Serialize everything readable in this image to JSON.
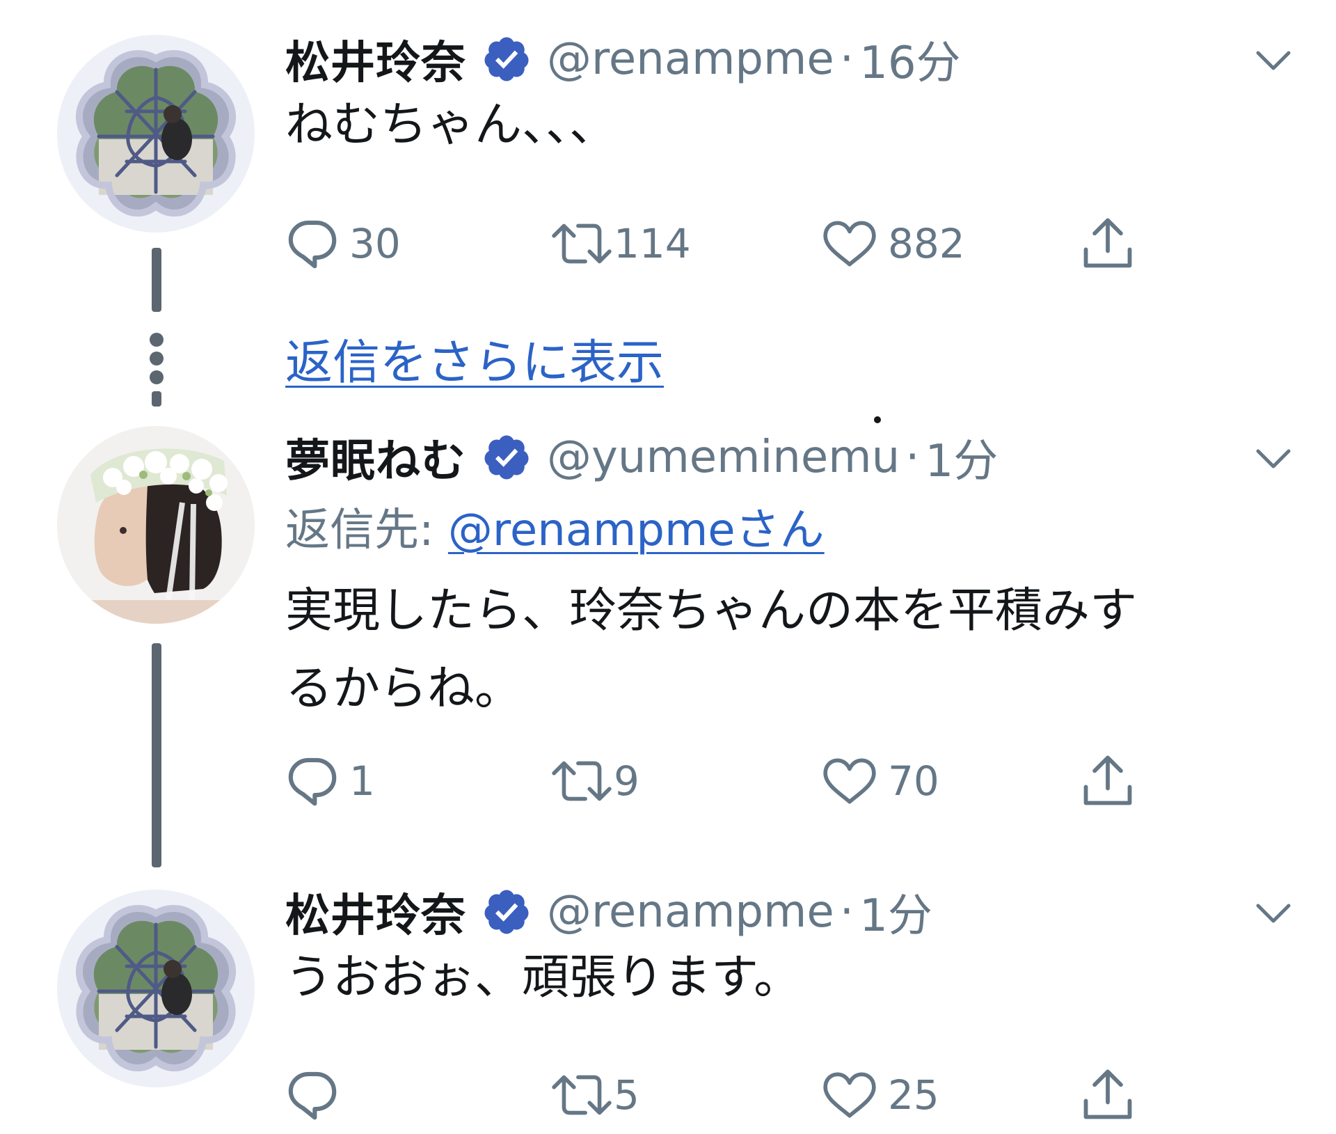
{
  "colors": {
    "text": "#14171a",
    "secondary": "#657786",
    "link": "#2b63c7",
    "verified": "#3b5fbf",
    "thread_line": "#5c6670"
  },
  "tweets": [
    {
      "display_name": "松井玲奈",
      "handle": "@renampme",
      "separator": "·",
      "time": "16分",
      "text": "ねむちゃん、、、",
      "counts": {
        "reply": "30",
        "retweet": "114",
        "like": "882"
      },
      "avatar": "plum-window-photo"
    },
    {
      "display_name": "夢眠ねむ",
      "handle": "@yumeminemu",
      "separator": "·",
      "time": "1分",
      "reply_prefix": "返信先: ",
      "reply_mention": "@renampmeさん",
      "text": "実現したら、玲奈ちゃんの本を平積みす\nるからね。",
      "counts": {
        "reply": "1",
        "retweet": "9",
        "like": "70"
      },
      "avatar": "flower-crown-portrait"
    },
    {
      "display_name": "松井玲奈",
      "handle": "@renampme",
      "separator": "·",
      "time": "1分",
      "text": "うおおぉ、頑張ります。",
      "counts": {
        "reply": "",
        "retweet": "5",
        "like": "25"
      },
      "avatar": "plum-window-photo"
    }
  ],
  "show_more_replies": "返信をさらに表示",
  "icons": [
    "verified-icon",
    "chevron-down-icon",
    "reply-icon",
    "retweet-icon",
    "like-icon",
    "share-icon"
  ]
}
